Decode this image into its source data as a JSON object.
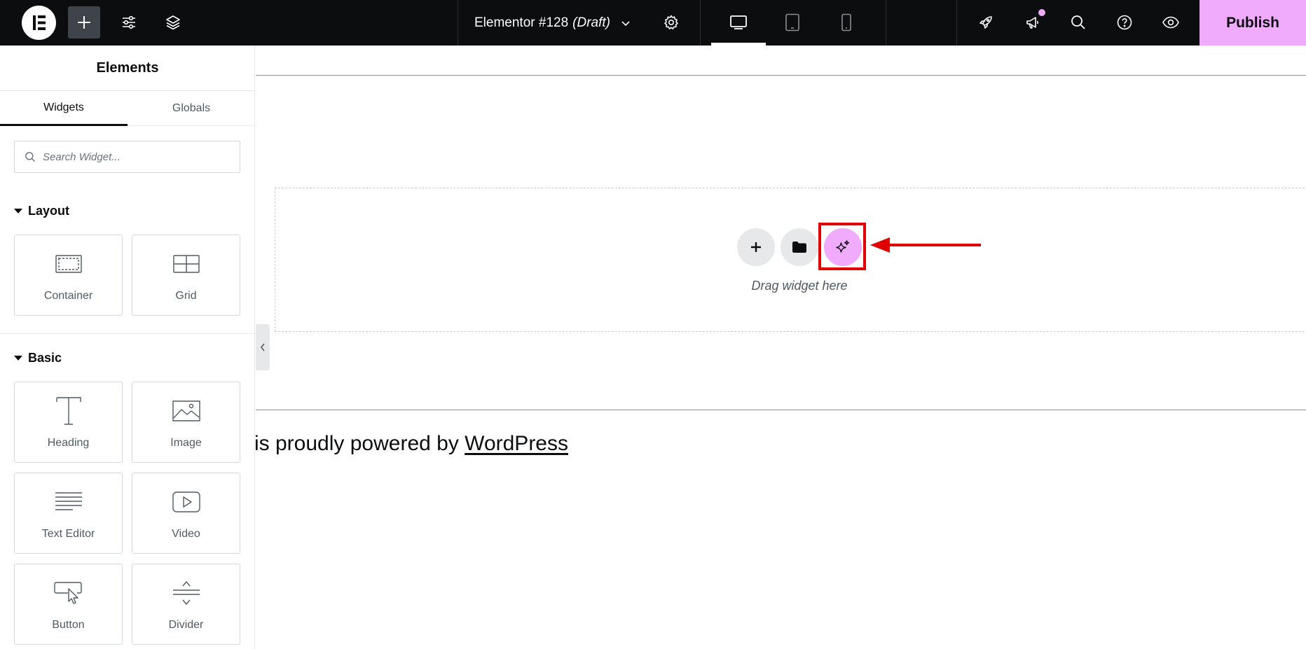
{
  "topbar": {
    "document_title": "Elementor #128",
    "document_status": "(Draft)",
    "publish_label": "Publish",
    "accent_color": "#f0abfc"
  },
  "sidebar": {
    "panel_title": "Elements",
    "tabs": [
      {
        "label": "Widgets",
        "active": true
      },
      {
        "label": "Globals",
        "active": false
      }
    ],
    "search_placeholder": "Search Widget...",
    "categories": [
      {
        "label": "Layout",
        "widgets": [
          {
            "label": "Container",
            "icon": "container-icon"
          },
          {
            "label": "Grid",
            "icon": "grid-icon"
          }
        ]
      },
      {
        "label": "Basic",
        "widgets": [
          {
            "label": "Heading",
            "icon": "heading-icon"
          },
          {
            "label": "Image",
            "icon": "image-icon"
          },
          {
            "label": "Text Editor",
            "icon": "text-editor-icon"
          },
          {
            "label": "Video",
            "icon": "video-icon"
          },
          {
            "label": "Button",
            "icon": "button-icon"
          },
          {
            "label": "Divider",
            "icon": "divider-icon"
          }
        ]
      }
    ]
  },
  "canvas": {
    "drop_zone_label": "Drag widget here",
    "footer_prefix": "is proudly powered by",
    "footer_link": "WordPress",
    "annotation_color": "#e00000"
  }
}
